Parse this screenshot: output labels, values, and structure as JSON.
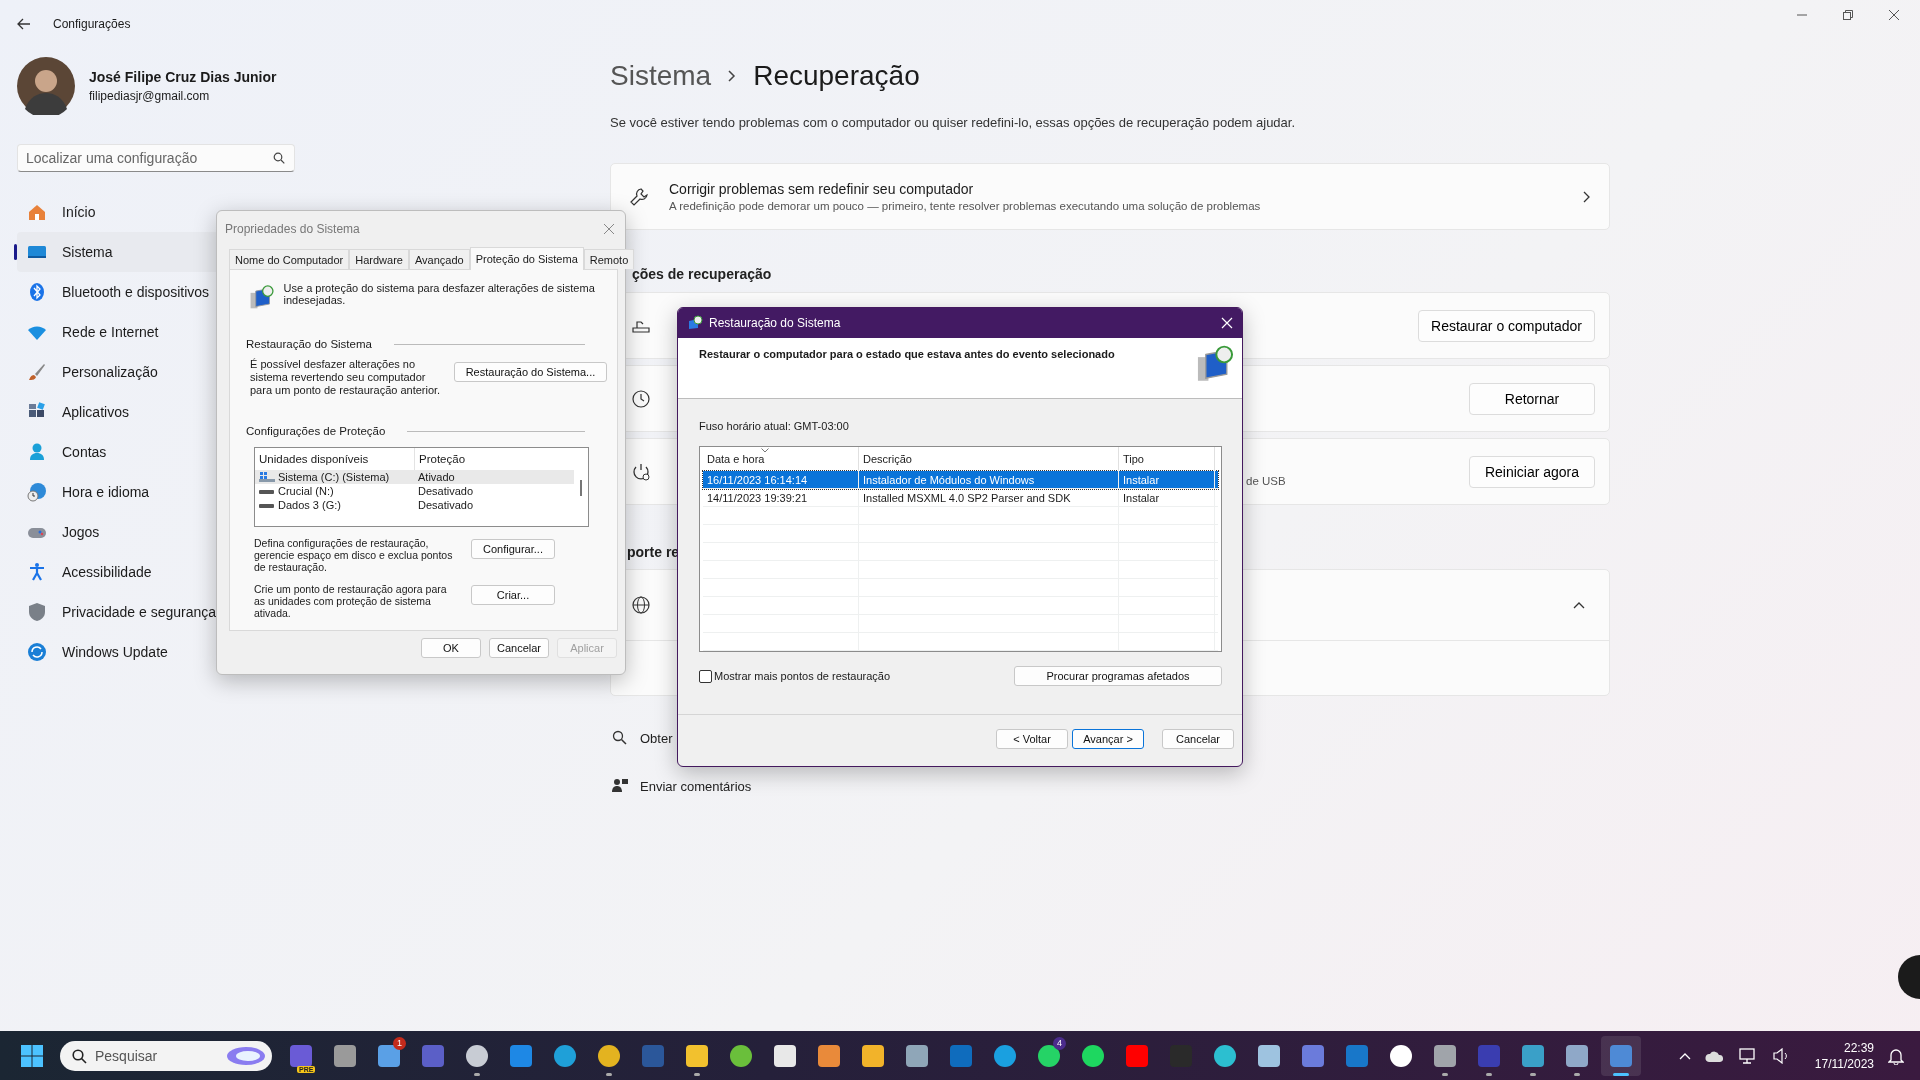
{
  "settings": {
    "title": "Configurações",
    "user": {
      "name": "José Filipe Cruz Dias Junior",
      "email": "filipediasjr@gmail.com"
    },
    "search": {
      "placeholder": "Localizar uma configuração"
    },
    "nav": [
      {
        "kind": "home",
        "label": "Início",
        "selected": false
      },
      {
        "kind": "system",
        "label": "Sistema",
        "selected": true
      },
      {
        "kind": "bluetooth",
        "label": "Bluetooth e dispositivos",
        "selected": false
      },
      {
        "kind": "network",
        "label": "Rede e Internet",
        "selected": false
      },
      {
        "kind": "brush",
        "label": "Personalização",
        "selected": false
      },
      {
        "kind": "apps",
        "label": "Aplicativos",
        "selected": false
      },
      {
        "kind": "accounts",
        "label": "Contas",
        "selected": false
      },
      {
        "kind": "time",
        "label": "Hora e idioma",
        "selected": false
      },
      {
        "kind": "games",
        "label": "Jogos",
        "selected": false
      },
      {
        "kind": "accessibility",
        "label": "Acessibilidade",
        "selected": false
      },
      {
        "kind": "privacy",
        "label": "Privacidade e segurança",
        "selected": false
      },
      {
        "kind": "update",
        "label": "Windows Update",
        "selected": false
      }
    ],
    "breadcrumb": {
      "parent": "Sistema",
      "current": "Recuperação"
    },
    "description": "Se você estiver tendo problemas com o computador ou quiser redefini-lo, essas opções de recuperação podem ajudar.",
    "fix_card": {
      "title": "Corrigir problemas sem redefinir seu computador",
      "subtitle": "A redefinição pode demorar um pouco — primeiro, tente resolver problemas executando uma solução de problemas"
    },
    "section_1": "ções de recuperação",
    "recovery_options": [
      {
        "kind": "reset",
        "button": "Restaurar o computador"
      },
      {
        "kind": "history",
        "button": "Retornar"
      },
      {
        "kind": "startup",
        "tail": "de USB",
        "button": "Reiniciar agora"
      }
    ],
    "section_2": "porte re",
    "support_card": {
      "expanded": true
    },
    "links": [
      {
        "kind": "help",
        "label": "Obter"
      },
      {
        "kind": "feedback",
        "label": "Enviar comentários"
      }
    ]
  },
  "system_properties": {
    "title": "Propriedades do Sistema",
    "tabs": [
      {
        "label": "Nome do Computador",
        "selected": false
      },
      {
        "label": "Hardware",
        "selected": false
      },
      {
        "label": "Avançado",
        "selected": false
      },
      {
        "label": "Proteção do Sistema",
        "selected": true
      },
      {
        "label": "Remoto",
        "selected": false
      }
    ],
    "intro": "Use a proteção do sistema para desfazer alterações de sistema indesejadas.",
    "restore_group": {
      "heading": "Restauração do Sistema",
      "text": "É possível desfazer alterações no sistema revertendo seu computador para um ponto de restauração anterior.",
      "button": "Restauração do Sistema..."
    },
    "protection_group": {
      "heading": "Configurações de Proteção",
      "columns": [
        "Unidades disponíveis",
        "Proteção"
      ],
      "drives": [
        {
          "kind": "system",
          "name": "Sistema (C:) (Sistema)",
          "protection": "Ativado",
          "selected": true
        },
        {
          "kind": "disk",
          "name": "Crucial (N:)",
          "protection": "Desativado",
          "selected": false
        },
        {
          "kind": "disk",
          "name": "Dados 3 (G:)",
          "protection": "Desativado",
          "selected": false
        }
      ],
      "actions": [
        {
          "text": "Defina configurações de restauração, gerencie espaço em disco e exclua pontos de restauração.",
          "button": "Configurar..."
        },
        {
          "text": "Crie um ponto de restauração agora para as unidades com proteção de sistema ativada.",
          "button": "Criar..."
        }
      ]
    },
    "buttons": [
      {
        "label": "OK",
        "disabled": false
      },
      {
        "label": "Cancelar",
        "disabled": false
      },
      {
        "label": "Aplicar",
        "disabled": true
      }
    ]
  },
  "restore_dialog": {
    "title": "Restauração do Sistema",
    "heading": "Restaurar o computador para o estado que estava antes do evento selecionado",
    "timezone": "Fuso horário atual: GMT-03:00",
    "columns": [
      {
        "label": "Data e hora",
        "sorted": true
      },
      {
        "label": "Descrição",
        "sorted": false
      },
      {
        "label": "Tipo",
        "sorted": false
      }
    ],
    "rows": [
      {
        "date": "16/11/2023 16:14:14",
        "description": "Instalador de Módulos do Windows",
        "type": "Instalar",
        "selected": true
      },
      {
        "date": "14/11/2023 19:39:21",
        "description": "Installed MSXML 4.0 SP2 Parser and SDK",
        "type": "Instalar",
        "selected": false
      }
    ],
    "show_more": {
      "label": "Mostrar mais pontos de restauração",
      "checked": false
    },
    "scan_button": "Procurar programas afetados",
    "buttons": [
      {
        "label": "< Voltar",
        "default": false
      },
      {
        "label": "Avançar >",
        "default": true
      },
      {
        "label": "Cancelar",
        "default": false
      }
    ]
  },
  "taskbar": {
    "search_placeholder": "Pesquisar",
    "apps": [
      {
        "kind": "square",
        "color": "#6a5bd6",
        "tag": "PRE",
        "running": false,
        "selected": false
      },
      {
        "kind": "square",
        "color": "#9a9a9a",
        "running": false,
        "selected": false
      },
      {
        "kind": "square",
        "color": "#5aa0e6",
        "badge": {
          "text": "1",
          "color": "#c42b1c"
        },
        "running": false,
        "selected": false
      },
      {
        "kind": "square",
        "color": "#5b5fc7",
        "running": false,
        "selected": false
      },
      {
        "kind": "circle",
        "color": "#c8ccd4",
        "running": true,
        "selected": false
      },
      {
        "kind": "square",
        "color": "#1e88e5",
        "running": false,
        "selected": false
      },
      {
        "kind": "circle",
        "color": "#1fa0d8",
        "running": false,
        "selected": false
      },
      {
        "kind": "circle",
        "color": "#e3b320",
        "running": true,
        "selected": false
      },
      {
        "kind": "square",
        "color": "#2b579a",
        "running": false,
        "selected": false
      },
      {
        "kind": "square",
        "color": "#f2c12e",
        "running": true,
        "selected": false
      },
      {
        "kind": "circle",
        "color": "#6abf3b",
        "running": false,
        "selected": false
      },
      {
        "kind": "square",
        "color": "#e8e8e8",
        "running": false,
        "selected": false
      },
      {
        "kind": "square",
        "color": "#e98a3a",
        "running": false,
        "selected": false
      },
      {
        "kind": "square",
        "color": "#f2b32a",
        "running": false,
        "selected": false
      },
      {
        "kind": "square",
        "color": "#8fa6b8",
        "running": false,
        "selected": false
      },
      {
        "kind": "square",
        "color": "#0f6cbd",
        "running": false,
        "selected": false
      },
      {
        "kind": "circle",
        "color": "#1aa0e0",
        "running": false,
        "selected": false
      },
      {
        "kind": "circle",
        "color": "#25d366",
        "badge": {
          "text": "4",
          "color": "#4b2c8c"
        },
        "running": false,
        "selected": false
      },
      {
        "kind": "circle",
        "color": "#1ed760",
        "running": false,
        "selected": false
      },
      {
        "kind": "square",
        "color": "#ff0000",
        "running": false,
        "selected": false
      },
      {
        "kind": "square",
        "color": "#2a2a2a",
        "running": false,
        "selected": false
      },
      {
        "kind": "circle",
        "color": "#2cbfd0",
        "running": false,
        "selected": false
      },
      {
        "kind": "square",
        "color": "#9ec3e0",
        "running": false,
        "selected": false
      },
      {
        "kind": "square",
        "color": "#6b7bdb",
        "running": false,
        "selected": false
      },
      {
        "kind": "square",
        "color": "#1877c9",
        "running": false,
        "selected": false
      },
      {
        "kind": "circle",
        "color": "#ffffff",
        "running": false,
        "selected": false
      },
      {
        "kind": "square",
        "color": "#a0a4aa",
        "running": true,
        "selected": false
      },
      {
        "kind": "square",
        "color": "#3a3db0",
        "running": true,
        "selected": false
      },
      {
        "kind": "square",
        "color": "#3aa0c8",
        "running": true,
        "selected": false
      },
      {
        "kind": "square",
        "color": "#8fa8c8",
        "running": true,
        "selected": false
      },
      {
        "kind": "square",
        "color": "#4e8ad6",
        "running": true,
        "selected": true
      }
    ],
    "clock": {
      "time": "22:39",
      "date": "17/11/2023"
    }
  }
}
